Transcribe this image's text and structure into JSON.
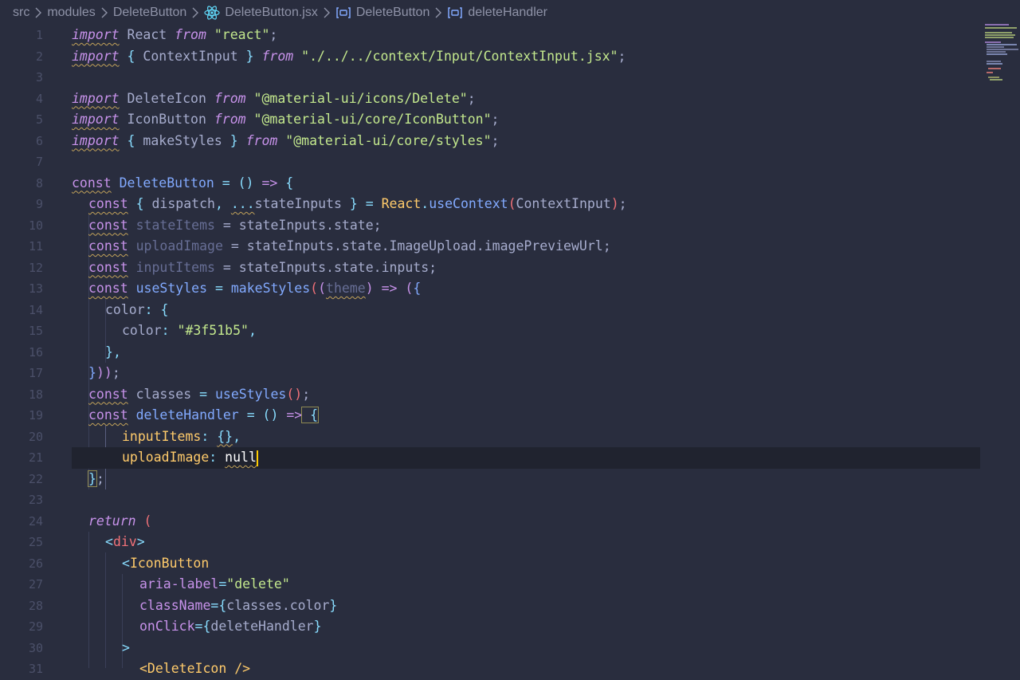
{
  "breadcrumb": {
    "items": [
      {
        "label": "src",
        "icon": ""
      },
      {
        "label": "modules",
        "icon": ""
      },
      {
        "label": "DeleteButton",
        "icon": ""
      },
      {
        "label": "DeleteButton.jsx",
        "icon": "react-icon"
      },
      {
        "label": "DeleteButton",
        "icon": "symbol-variable-icon"
      },
      {
        "label": "deleteHandler",
        "icon": "symbol-variable-icon"
      }
    ]
  },
  "editor": {
    "current_line": 21,
    "line_numbers": [
      "1",
      "2",
      "3",
      "4",
      "5",
      "6",
      "7",
      "8",
      "9",
      "10",
      "11",
      "12",
      "13",
      "14",
      "15",
      "16",
      "17",
      "18",
      "19",
      "20",
      "21",
      "22",
      "23",
      "24",
      "25",
      "26",
      "27",
      "28",
      "29",
      "30",
      "31"
    ]
  },
  "code": {
    "l1": {
      "import": "import",
      "name": " React ",
      "from": "from",
      "src": " \"react\"",
      "semi": ";"
    },
    "l2": {
      "import": "import",
      "open": " { ",
      "name": "ContextInput",
      "close": " } ",
      "from": "from",
      "src": " \"./../../context/Input/ContextInput.jsx\"",
      "semi": ";"
    },
    "l4": {
      "import": "import",
      "name": " DeleteIcon ",
      "from": "from",
      "src": " \"@material-ui/icons/Delete\"",
      "semi": ";"
    },
    "l5": {
      "import": "import",
      "name": " IconButton ",
      "from": "from",
      "src": " \"@material-ui/core/IconButton\"",
      "semi": ";"
    },
    "l6": {
      "import": "import",
      "open": " { ",
      "name": "makeStyles",
      "close": " } ",
      "from": "from",
      "src": " \"@material-ui/core/styles\"",
      "semi": ";"
    },
    "l8": {
      "const": "const",
      "name": " DeleteButton ",
      "eq": "=",
      "parens": " () ",
      "arrow": "=>",
      "brace": " {"
    },
    "l9": {
      "const": "const",
      "open": " { ",
      "a": "dispatch",
      "comma": ", ",
      "spread": "...",
      "b": "stateInputs",
      "close": " } ",
      "eq": "= ",
      "react": "React",
      "dot": ".",
      "fn": "useContext",
      "lp": "(",
      "arg": "ContextInput",
      "rp": ")",
      "semi": ";"
    },
    "l10": {
      "const": "const",
      "name": " stateItems",
      "rest": " = stateInputs.state;"
    },
    "l11": {
      "const": "const",
      "name": " uploadImage",
      "rest": " = stateInputs.state.ImageUpload.imagePreviewUrl;"
    },
    "l12": {
      "const": "const",
      "name": " inputItems",
      "rest": " = stateInputs.state.inputs;"
    },
    "l13": {
      "const": "const",
      "name": " useStyles ",
      "eq": "= ",
      "fn": "makeStyles",
      "lp": "(",
      "lp2": "(",
      "arg": "theme",
      "rp": ")",
      "arrow": " => ",
      "lp3": "(",
      "brace": "{"
    },
    "l14": {
      "key": "color",
      "colon": ": ",
      "brace": "{"
    },
    "l15": {
      "key": "color",
      "colon": ": ",
      "val": "\"#3f51b5\"",
      "comma": ","
    },
    "l16": {
      "brace": "}",
      "comma": ","
    },
    "l17": {
      "brace": "}",
      "rp": "))",
      "semi": ";"
    },
    "l18": {
      "const": "const",
      "name": " classes ",
      "eq": "= ",
      "fn": "useStyles",
      "parens": "()",
      "semi": ";"
    },
    "l19": {
      "const": "const",
      "name": " deleteHandler ",
      "eq": "=",
      "parens": " () ",
      "arrow": "=>",
      "brace": " {"
    },
    "l20": {
      "key": "inputItems",
      "colon": ": ",
      "val": "{}",
      "comma": ","
    },
    "l21": {
      "key": "uploadImage",
      "colon": ": ",
      "val": "null"
    },
    "l22": {
      "brace": "}",
      "semi": ";"
    },
    "l24": {
      "ret": "return",
      "paren": " ("
    },
    "l25": {
      "lt": "<",
      "tag": "div",
      "gt": ">"
    },
    "l26": {
      "lt": "<",
      "tag": "IconButton"
    },
    "l27": {
      "attr": "aria-label",
      "eq": "=",
      "val": "\"delete\""
    },
    "l28": {
      "attr": "className",
      "eq": "=",
      "lb": "{",
      "expr": "classes.color",
      "rb": "}"
    },
    "l29": {
      "attr": "onClick",
      "eq": "=",
      "lb": "{",
      "expr": "deleteHandler",
      "rb": "}"
    },
    "l30": {
      "gt": ">"
    },
    "l31": {
      "text": "<DeleteIcon />"
    }
  }
}
